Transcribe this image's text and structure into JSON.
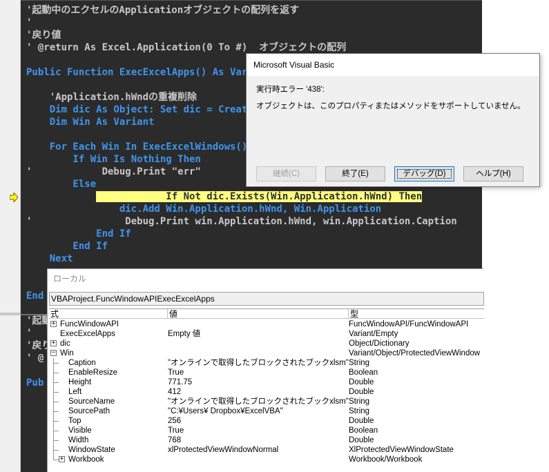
{
  "code_lines": [
    {
      "text": "'起動中のエクセルのApplicationオブジェクトの配列を返す",
      "kind": "comment"
    },
    {
      "text": "'",
      "kind": "comment"
    },
    {
      "text": "'戻り値",
      "kind": "comment"
    },
    {
      "text": "' @return As Excel.Application(0 To #)  オブジェクトの配列",
      "kind": "comment"
    },
    {
      "text": "",
      "kind": "code"
    },
    {
      "text": "Public Function ExecExcelApps() As Varia",
      "kind": "code"
    },
    {
      "text": "",
      "kind": "code"
    },
    {
      "text": "    'Application.hWndの重複削除",
      "kind": "comment"
    },
    {
      "text": "    Dim dic As Object: Set dic = CreateO",
      "kind": "code"
    },
    {
      "text": "    Dim Win As Variant",
      "kind": "code"
    },
    {
      "text": "",
      "kind": "code"
    },
    {
      "text": "    For Each Win In ExecExcelWindows()",
      "kind": "code"
    },
    {
      "text": "        If Win Is Nothing Then",
      "kind": "code"
    },
    {
      "text": "'            Debug.Print \"err\"",
      "kind": "comment"
    },
    {
      "text": "        Else",
      "kind": "code"
    },
    {
      "text": "            If Not dic.Exists(Win.Application.hWnd) Then",
      "kind": "highlight",
      "prefix": "            "
    },
    {
      "text": "                dic.Add Win.Application.hWnd, Win.Application",
      "kind": "code"
    },
    {
      "text": "'                Debug.Print win.Application.hWnd, win.Application.Caption",
      "kind": "comment"
    },
    {
      "text": "            End If",
      "kind": "code"
    },
    {
      "text": "        End If",
      "kind": "code"
    },
    {
      "text": "    Next",
      "kind": "code"
    },
    {
      "text": "",
      "kind": "code"
    },
    {
      "text": "",
      "kind": "code"
    },
    {
      "text": "End",
      "kind": "code"
    },
    {
      "text": "",
      "kind": "code"
    },
    {
      "text": "'起動",
      "kind": "comment"
    },
    {
      "text": "'",
      "kind": "comment"
    },
    {
      "text": "'戻り",
      "kind": "comment"
    },
    {
      "text": "' @",
      "kind": "comment"
    },
    {
      "text": "",
      "kind": "code"
    },
    {
      "text": "Pub",
      "kind": "code"
    }
  ],
  "locals": {
    "title": "ローカル",
    "context": "VBAProject.FuncWindowAPIExecExcelApps",
    "headers": {
      "expr": "式",
      "value": "値",
      "type": "型"
    },
    "rows": [
      {
        "expr": "FuncWindowAPI",
        "value": "",
        "type": "FuncWindowAPI/FuncWindowAPI",
        "level": 0,
        "expander": "+"
      },
      {
        "expr": "ExecExcelApps",
        "value": "Empty 値",
        "type": "Variant/Empty",
        "level": 0,
        "expander": ""
      },
      {
        "expr": "dic",
        "value": "",
        "type": "Object/Dictionary",
        "level": 0,
        "expander": "+"
      },
      {
        "expr": "Win",
        "value": "",
        "type": "Variant/Object/ProtectedViewWindow",
        "level": 0,
        "expander": "-"
      },
      {
        "expr": "Caption",
        "value": "\"オンラインで取得したブロックされたブックxlsm\"",
        "type": "String",
        "level": 1,
        "expander": ""
      },
      {
        "expr": "EnableResize",
        "value": "True",
        "type": "Boolean",
        "level": 1,
        "expander": ""
      },
      {
        "expr": "Height",
        "value": "771.75",
        "type": "Double",
        "level": 1,
        "expander": ""
      },
      {
        "expr": "Left",
        "value": "412",
        "type": "Double",
        "level": 1,
        "expander": ""
      },
      {
        "expr": "SourceName",
        "value": "\"オンラインで取得したブロックされたブックxlsm\"",
        "type": "String",
        "level": 1,
        "expander": ""
      },
      {
        "expr": "SourcePath",
        "value": "\"C:¥Users¥           Dropbox¥ExcelVBA\"",
        "type": "String",
        "level": 1,
        "expander": ""
      },
      {
        "expr": "Top",
        "value": "256",
        "type": "Double",
        "level": 1,
        "expander": ""
      },
      {
        "expr": "Visible",
        "value": "True",
        "type": "Boolean",
        "level": 1,
        "expander": ""
      },
      {
        "expr": "Width",
        "value": "768",
        "type": "Double",
        "level": 1,
        "expander": ""
      },
      {
        "expr": "WindowState",
        "value": "xlProtectedViewWindowNormal",
        "type": "XlProtectedViewWindowState",
        "level": 1,
        "expander": ""
      },
      {
        "expr": "Workbook",
        "value": "",
        "type": "Workbook/Workbook",
        "level": 1,
        "expander": "+"
      }
    ]
  },
  "dialog": {
    "title": "Microsoft Visual Basic",
    "error_title": "実行時エラー '438':",
    "error_message": "オブジェクトは、このプロパティまたはメソッドをサポートしていません。",
    "buttons": {
      "continue": "継続(C)",
      "end": "終了(E)",
      "debug": "デバッグ(D)",
      "help": "ヘルプ(H)"
    }
  },
  "colors": {
    "editor_bg": "#2b2b2b",
    "keyword": "#3f95ee",
    "comment": "#c8c8c8",
    "highlight": "#ffff80",
    "exec_arrow": "#ffff00"
  },
  "icons": {
    "execution_pointer": "yellow-arrow-icon"
  }
}
